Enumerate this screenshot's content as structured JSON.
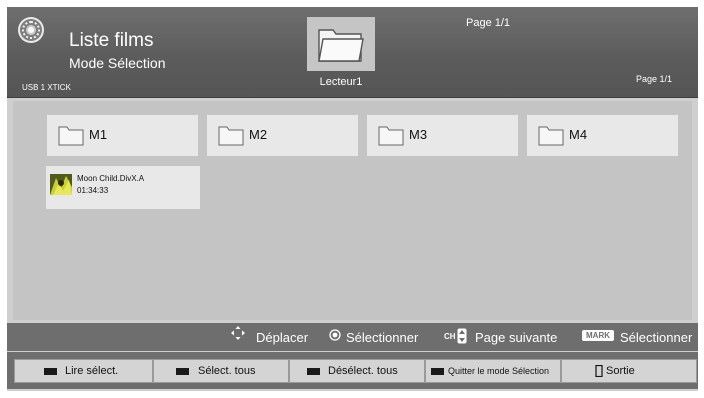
{
  "header": {
    "title": "Liste films",
    "subtitle": "Mode Sélection",
    "device": "USB 1 XTICK",
    "current_folder": "Lecteur1",
    "page_top": "Page 1/1",
    "page_right": "Page 1/1"
  },
  "folders": [
    {
      "label": "M1",
      "icon": "folder-icon"
    },
    {
      "label": "M2",
      "icon": "folder-icon"
    },
    {
      "label": "M3",
      "icon": "folder-icon"
    },
    {
      "label": "M4",
      "icon": "folder-icon"
    }
  ],
  "video": {
    "title": "Moon Child.DivX.A",
    "duration": "01:34:33"
  },
  "nav": {
    "move": "Déplacer",
    "select_ok": "Sélectionner",
    "ch_badge": "CH",
    "next_page": "Page suivante",
    "mark_badge": "MARK",
    "select_mark": "Sélectionner"
  },
  "buttons": [
    {
      "label": "Lire sélect."
    },
    {
      "label": "Sélect. tous"
    },
    {
      "label": "Désélect. tous"
    },
    {
      "label": "Quitter le mode Sélection"
    },
    {
      "label": "Sortie"
    }
  ],
  "colors": {
    "header": "#5c5c5c",
    "content": "#c4c4c4",
    "tile": "#e8e8e8",
    "bar": "#6e6e6e",
    "button": "#d4d4d4"
  }
}
